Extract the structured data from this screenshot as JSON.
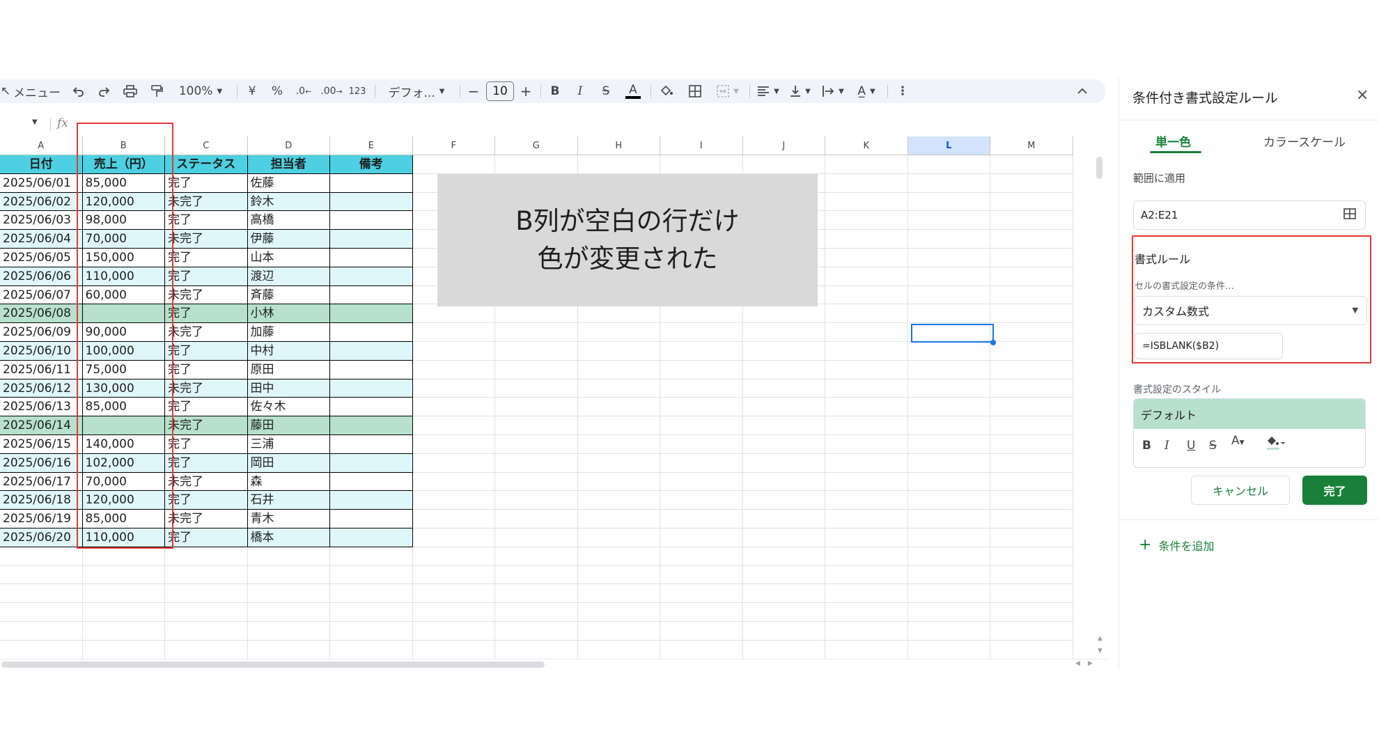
{
  "toolbar": {
    "menu_label": "メニュー",
    "zoom": "100%",
    "currency": "¥",
    "percent": "%",
    "dec_decrease": ".0",
    "dec_increase": ".00",
    "number_format": "123",
    "font": "デフォ...",
    "font_size": "10",
    "minus": "−",
    "plus": "+",
    "bold": "B",
    "italic": "I",
    "strike": "S",
    "text_color": "A",
    "more": "⋮",
    "collapse": "^"
  },
  "formula_bar": {
    "fx": "fx"
  },
  "columns": [
    "A",
    "B",
    "C",
    "D",
    "E",
    "F",
    "G",
    "H",
    "I",
    "J",
    "K",
    "L",
    "M"
  ],
  "selected_column": "L",
  "table": {
    "headers": [
      "日付",
      "売上（円）",
      "ステータス",
      "担当者",
      "備考"
    ],
    "rows": [
      [
        "2025/06/01",
        "85,000",
        "完了",
        "佐藤",
        ""
      ],
      [
        "2025/06/02",
        "120,000",
        "未完了",
        "鈴木",
        ""
      ],
      [
        "2025/06/03",
        "98,000",
        "完了",
        "高橋",
        ""
      ],
      [
        "2025/06/04",
        "70,000",
        "未完了",
        "伊藤",
        ""
      ],
      [
        "2025/06/05",
        "150,000",
        "完了",
        "山本",
        ""
      ],
      [
        "2025/06/06",
        "110,000",
        "完了",
        "渡辺",
        ""
      ],
      [
        "2025/06/07",
        "60,000",
        "未完了",
        "斉藤",
        ""
      ],
      [
        "2025/06/08",
        "",
        "完了",
        "小林",
        ""
      ],
      [
        "2025/06/09",
        "90,000",
        "未完了",
        "加藤",
        ""
      ],
      [
        "2025/06/10",
        "100,000",
        "完了",
        "中村",
        ""
      ],
      [
        "2025/06/11",
        "75,000",
        "完了",
        "原田",
        ""
      ],
      [
        "2025/06/12",
        "130,000",
        "未完了",
        "田中",
        ""
      ],
      [
        "2025/06/13",
        "85,000",
        "完了",
        "佐々木",
        ""
      ],
      [
        "2025/06/14",
        "",
        "未完了",
        "藤田",
        ""
      ],
      [
        "2025/06/15",
        "140,000",
        "完了",
        "三浦",
        ""
      ],
      [
        "2025/06/16",
        "102,000",
        "完了",
        "岡田",
        ""
      ],
      [
        "2025/06/17",
        "70,000",
        "未完了",
        "森",
        ""
      ],
      [
        "2025/06/18",
        "120,000",
        "完了",
        "石井",
        ""
      ],
      [
        "2025/06/19",
        "85,000",
        "未完了",
        "青木",
        ""
      ],
      [
        "2025/06/20",
        "110,000",
        "完了",
        "橋本",
        ""
      ]
    ]
  },
  "callout": {
    "line1": "B列が空白の行だけ",
    "line2": "色が変更された"
  },
  "panel": {
    "title": "条件付き書式設定ルール",
    "close": "×",
    "tab_single": "単一色",
    "tab_color_scale": "カラースケール",
    "apply_range_label": "範囲に適用",
    "range_value": "A2:E21",
    "format_rules_label": "書式ルール",
    "condition_label": "セルの書式設定の条件…",
    "condition_value": "カスタム数式",
    "formula_value": "=ISBLANK($B2)",
    "style_label": "書式設定のスタイル",
    "style_preview": "デフォルト",
    "style_buttons": [
      "B",
      "I",
      "U",
      "S",
      "A"
    ],
    "cancel": "キャンセル",
    "done": "完了",
    "add_condition": "条件を追加",
    "add_icon": "+"
  },
  "colors": {
    "header_fill": "#4dd0e1",
    "band_fill": "#e0f7fa",
    "blank_row_fill": "#b7e1cd",
    "accent_green": "#188038",
    "highlight_red": "#e53935",
    "selection_blue": "#1a73e8"
  }
}
